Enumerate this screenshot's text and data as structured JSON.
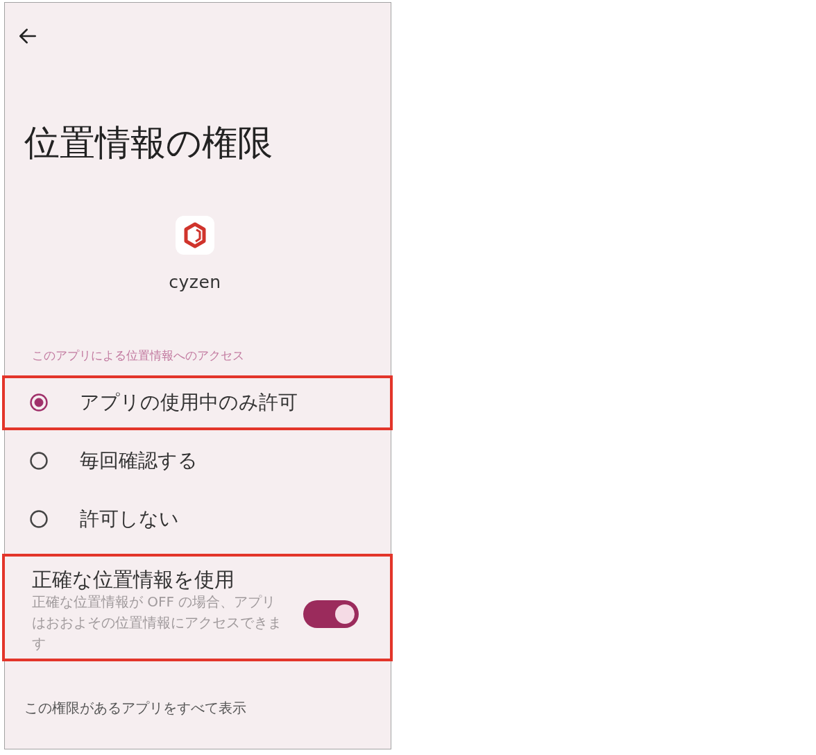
{
  "title": "位置情報の権限",
  "app": {
    "name": "cyzen"
  },
  "access_section": {
    "heading": "このアプリによる位置情報へのアクセス",
    "options": [
      {
        "label": "アプリの使用中のみ許可",
        "selected": true,
        "highlighted": true
      },
      {
        "label": "毎回確認する",
        "selected": false,
        "highlighted": false
      },
      {
        "label": "許可しない",
        "selected": false,
        "highlighted": false
      }
    ]
  },
  "precise_location": {
    "title": "正確な位置情報を使用",
    "description": "正確な位置情報が OFF の場合、アプリはおおよその位置情報にアクセスできます",
    "on": true,
    "highlighted": true
  },
  "footer_link": "この権限があるアプリをすべて表示"
}
